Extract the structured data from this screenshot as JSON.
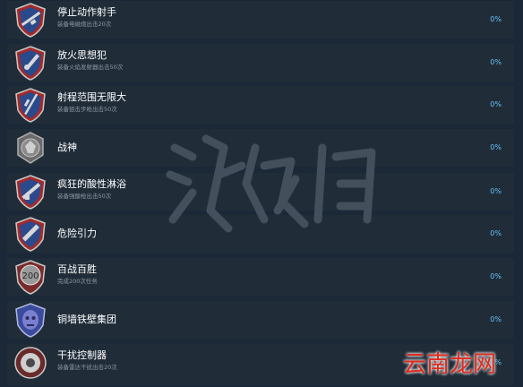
{
  "achievements": [
    {
      "title": "停止动作射手",
      "desc": "装备电磁炮出击20次",
      "percent": "0%",
      "icon": "rifle-shield-icon"
    },
    {
      "title": "放火思想犯",
      "desc": "装备火焰发射器出击50次",
      "percent": "0%",
      "icon": "flamethrower-shield-icon"
    },
    {
      "title": "射程范围无限大",
      "desc": "装备狙击步枪出击50次",
      "percent": "0%",
      "icon": "sniper-shield-icon"
    },
    {
      "title": "战神",
      "desc": "",
      "percent": "0%",
      "icon": "war-god-emblem-icon"
    },
    {
      "title": "疯狂的酸性淋浴",
      "desc": "装备强酸枪出击50次",
      "percent": "0%",
      "icon": "acid-gun-shield-icon"
    },
    {
      "title": "危险引力",
      "desc": "",
      "percent": "0%",
      "icon": "gravity-gun-shield-icon"
    },
    {
      "title": "百战百胜",
      "desc": "完成200次任务",
      "percent": "0%",
      "icon": "200-medal-icon"
    },
    {
      "title": "铜墙铁壁集团",
      "desc": "",
      "percent": "0%",
      "icon": "mask-emblem-icon"
    },
    {
      "title": "干扰控制器",
      "desc": "装备雷达干扰出击20次",
      "percent": "0%",
      "icon": "jammer-device-icon"
    }
  ],
  "watermark": {
    "text": "游侠网"
  },
  "corner_logo": {
    "text": "云南龙网"
  },
  "colors": {
    "background": "#1b2838",
    "row": "#202d39",
    "title": "#ffffff",
    "desc": "#8f98a0",
    "percent": "#66c0f4",
    "shield_blue": "#2a4a8c",
    "shield_red": "#a32a2a"
  }
}
